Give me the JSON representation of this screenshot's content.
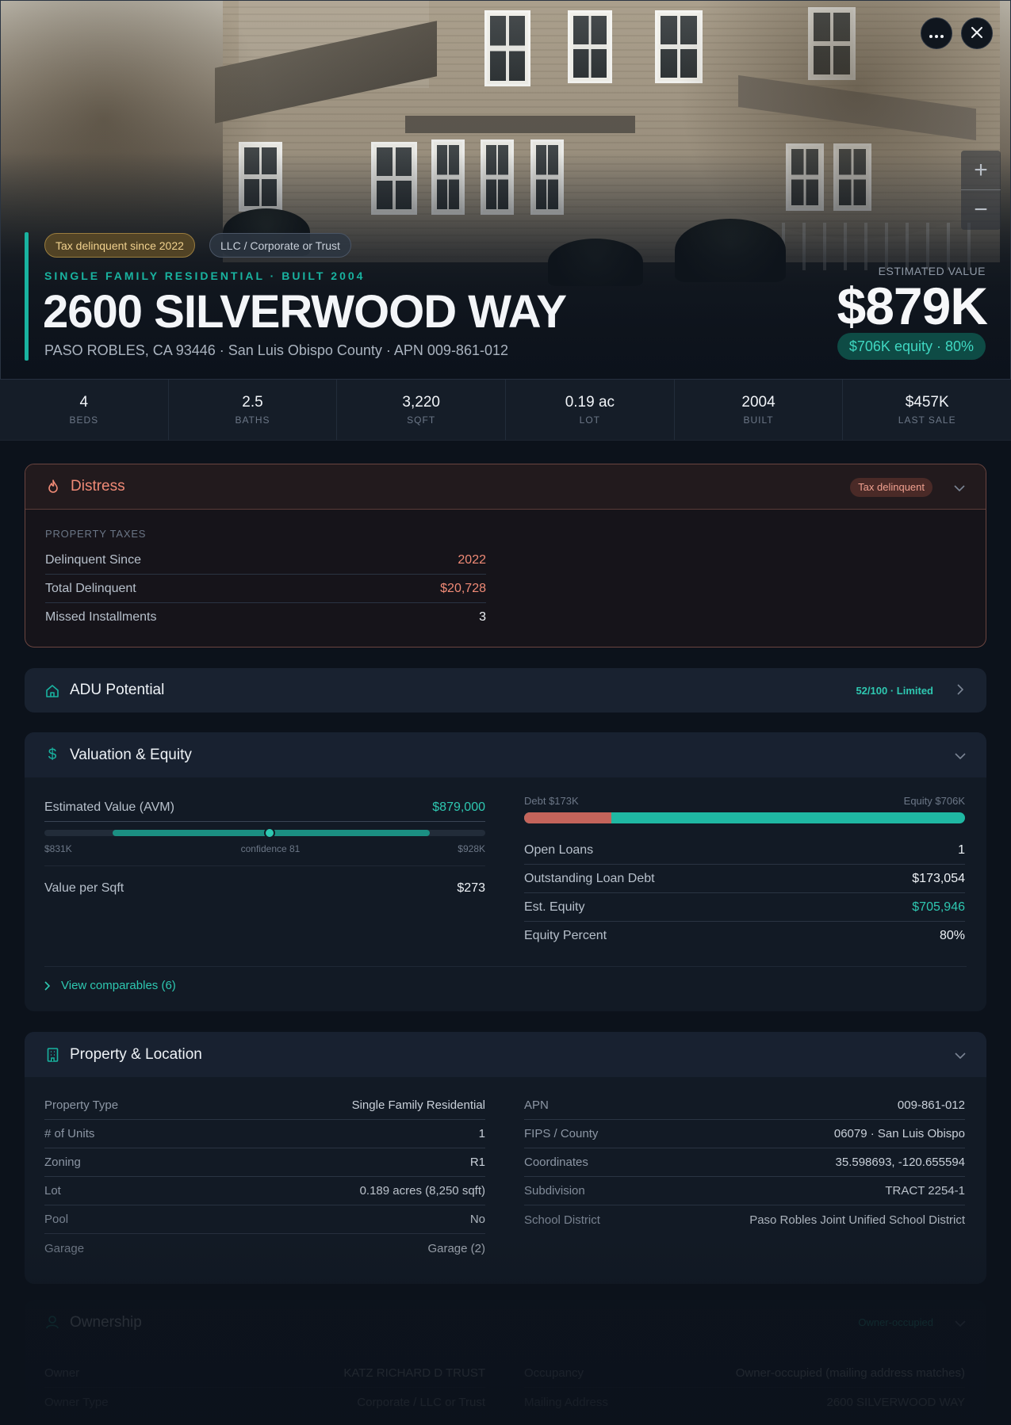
{
  "hero": {
    "tags": [
      "Tax delinquent since 2022",
      "LLC / Corporate or Trust"
    ],
    "subtitle": "SINGLE FAMILY RESIDENTIAL · BUILT 2004",
    "title": "2600 SILVERWOOD WAY",
    "address_line": "PASO ROBLES, CA 93446 · San Luis Obispo County · APN 009-861-012",
    "estimated_value_label": "ESTIMATED VALUE",
    "estimated_value": "$879K",
    "equity_pill": "$706K equity · 80%",
    "more_icon": "more-horizontal-icon",
    "close_icon": "close-icon",
    "zoom_in": "+",
    "zoom_out": "−"
  },
  "stats": [
    {
      "value": "4",
      "label": "BEDS"
    },
    {
      "value": "2.5",
      "label": "BATHS"
    },
    {
      "value": "3,220",
      "label": "SQFT"
    },
    {
      "value": "0.19 ac",
      "label": "LOT"
    },
    {
      "value": "2004",
      "label": "BUILT"
    },
    {
      "value": "$457K",
      "label": "LAST SALE"
    }
  ],
  "distress": {
    "title": "Distress",
    "icon": "flame-icon",
    "badge": "Tax delinquent",
    "section_label": "PROPERTY TAXES",
    "rows": [
      {
        "label": "Delinquent Since",
        "value": "2022"
      },
      {
        "label": "Total Delinquent",
        "value": "$20,728"
      },
      {
        "label": "Missed Installments",
        "value": "3"
      }
    ]
  },
  "adu": {
    "title": "ADU Potential",
    "icon": "home-icon",
    "badge": "52/100 · Limited"
  },
  "valuation": {
    "title": "Valuation & Equity",
    "icon": "dollar-icon",
    "avm_label": "Estimated Value (AVM)",
    "avm_value": "$879,000",
    "range_low": "$831K",
    "range_mid": "confidence 81",
    "range_high": "$928K",
    "range_low_value": 831,
    "range_high_value": 928,
    "range_point_value": 879,
    "range_scale_min": 810,
    "range_scale_max": 945,
    "value_per_sqft_label": "Value per Sqft",
    "value_per_sqft": "$273",
    "debt_label": "Debt $173K",
    "equity_label": "Equity $706K",
    "debt_fraction": 0.197,
    "rows": [
      {
        "label": "Open Loans",
        "value": "1"
      },
      {
        "label": "Outstanding Loan Debt",
        "value": "$173,054"
      },
      {
        "label": "Est. Equity",
        "value": "$705,946"
      },
      {
        "label": "Equity Percent",
        "value": "80%"
      }
    ],
    "comps_link": "View comparables (6)"
  },
  "property": {
    "title": "Property & Location",
    "icon": "building-icon",
    "left": [
      {
        "label": "Property Type",
        "value": "Single Family Residential"
      },
      {
        "label": "# of Units",
        "value": "1"
      },
      {
        "label": "Zoning",
        "value": "R1"
      },
      {
        "label": "Lot",
        "value": "0.189 acres (8,250 sqft)"
      },
      {
        "label": "Pool",
        "value": "No"
      },
      {
        "label": "Garage",
        "value": "Garage (2)"
      }
    ],
    "right": [
      {
        "label": "APN",
        "value": "009-861-012"
      },
      {
        "label": "FIPS / County",
        "value": "06079 · San Luis Obispo"
      },
      {
        "label": "Coordinates",
        "value": "35.598693, -120.655594"
      },
      {
        "label": "Subdivision",
        "value": "TRACT 2254-1"
      },
      {
        "label": "School District",
        "value": "Paso Robles Joint Unified School District"
      }
    ]
  },
  "ownership": {
    "title": "Ownership",
    "icon": "user-icon",
    "badge": "Owner-occupied",
    "left": [
      {
        "label": "Owner",
        "value": "KATZ RICHARD D TRUST"
      },
      {
        "label": "Owner Type",
        "value": "Corporate / LLC or Trust"
      }
    ],
    "right": [
      {
        "label": "Occupancy",
        "value": "Owner-occupied (mailing address matches)"
      },
      {
        "label": "Mailing Address",
        "value": "2600 SILVERWOOD WAY"
      }
    ]
  },
  "colors": {
    "accent": "#19b3a0",
    "distress": "#f08a76",
    "tax_chip": "#f1d28e",
    "background": "#0c121b"
  }
}
